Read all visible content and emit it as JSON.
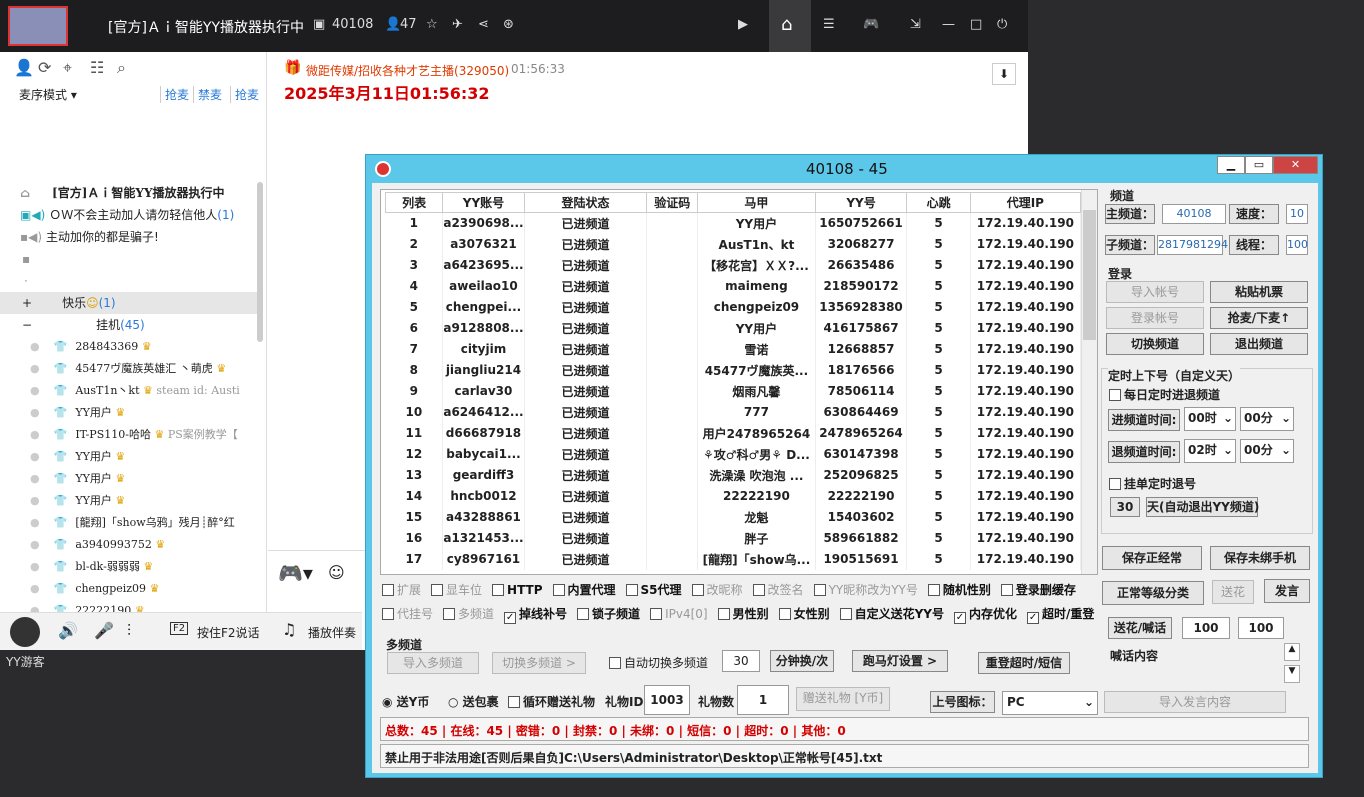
{
  "yy": {
    "title": "[官方]Ａｉ智能YY播放器执行中",
    "room_id": "40108",
    "online": "47",
    "left_tabs": [
      "抢麦",
      "禁麦",
      "抢麦"
    ],
    "mode": "麦序模式",
    "channels": [
      {
        "name": "[官方]Ａｉ智能YY播放器执行中"
      },
      {
        "name": "ＯＷ不会主动加人请勿轻信他人",
        "count": "(1)"
      },
      {
        "name": "主动加你的都是骗子!"
      },
      {
        "name": ""
      },
      {
        "name": "·"
      }
    ],
    "group_happy": "快乐",
    "group_happy_count": "(1)",
    "group_hang": "挂机",
    "group_hang_count": "(45)",
    "users": [
      {
        "name": "284843369",
        "badge": "♛"
      },
      {
        "name": "45477ヴ魔族英雄汇 丶萌虎",
        "badge": "♛"
      },
      {
        "name": "AusT1n丶kt",
        "badge": "♛",
        "sub": "steam id: Austi"
      },
      {
        "name": "YY用户",
        "badge": "♛"
      },
      {
        "name": "IT-PS110-哈哈",
        "badge": "♛",
        "sub": "PS案例教学【"
      },
      {
        "name": "YY用户",
        "badge": "♛"
      },
      {
        "name": "YY用户",
        "badge": "♛"
      },
      {
        "name": "YY用户",
        "badge": "♛"
      },
      {
        "name": "[龍翔]「show乌鸦」残月┊醉°红",
        "badge": ""
      },
      {
        "name": "a3940993752",
        "badge": "♛"
      },
      {
        "name": "bl-dk-弱弱弱",
        "badge": "♛"
      },
      {
        "name": "chengpeiz09",
        "badge": "♛"
      },
      {
        "name": "22222190",
        "badge": "♛"
      }
    ],
    "chat_sender": "微距传媒/招收各种才艺主播(329050)",
    "chat_time": "01:56:33",
    "chat_msg": "2025年3月11日01:56:32",
    "bottom_f2": "按住F2说话",
    "bottom_music": "播放伴奏",
    "guest": "YY游客",
    "colors": {
      "accent": "#e03a00",
      "red": "#d40000"
    }
  },
  "tool": {
    "title": "40108 - 45",
    "columns": [
      "列表",
      "YY账号",
      "登陆状态",
      "验证码",
      "马甲",
      "YY号",
      "心跳",
      "代理IP"
    ],
    "rows": [
      [
        "1",
        "a2390698...",
        "已进频道",
        "",
        "YY用户",
        "1650752661",
        "5",
        "172.19.40.190"
      ],
      [
        "2",
        "a3076321",
        "已进频道",
        "",
        "AusT1n、kt",
        "32068277",
        "5",
        "172.19.40.190"
      ],
      [
        "3",
        "a6423695...",
        "已进频道",
        "",
        "【移花宫】ＸＸ?...",
        "26635486",
        "5",
        "172.19.40.190"
      ],
      [
        "4",
        "aweilao10",
        "已进频道",
        "",
        "maimeng",
        "218590172",
        "5",
        "172.19.40.190"
      ],
      [
        "5",
        "chengpei...",
        "已进频道",
        "",
        "chengpeiz09",
        "1356928380",
        "5",
        "172.19.40.190"
      ],
      [
        "6",
        "a9128808...",
        "已进频道",
        "",
        "YY用户",
        "416175867",
        "5",
        "172.19.40.190"
      ],
      [
        "7",
        "cityjim",
        "已进频道",
        "",
        "雪诺",
        "12668857",
        "5",
        "172.19.40.190"
      ],
      [
        "8",
        "jiangliu214",
        "已进频道",
        "",
        "45477ヴ魔族英...",
        "18176566",
        "5",
        "172.19.40.190"
      ],
      [
        "9",
        "carlav30",
        "已进频道",
        "",
        "烟雨凡馨",
        "78506114",
        "5",
        "172.19.40.190"
      ],
      [
        "10",
        "a6246412...",
        "已进频道",
        "",
        "777",
        "630864469",
        "5",
        "172.19.40.190"
      ],
      [
        "11",
        "d66687918",
        "已进频道",
        "",
        "用户2478965264",
        "2478965264",
        "5",
        "172.19.40.190"
      ],
      [
        "12",
        "babycai1...",
        "已进频道",
        "",
        "⚘攻♂科♂男⚘ D...",
        "630147398",
        "5",
        "172.19.40.190"
      ],
      [
        "13",
        "geardiff3",
        "已进频道",
        "",
        "洗澡澡 吹泡泡 ...",
        "252096825",
        "5",
        "172.19.40.190"
      ],
      [
        "14",
        "hncb0012",
        "已进频道",
        "",
        "22222190",
        "22222190",
        "5",
        "172.19.40.190"
      ],
      [
        "15",
        "a43288861",
        "已进频道",
        "",
        "龙魁",
        "15403602",
        "5",
        "172.19.40.190"
      ],
      [
        "16",
        "a1321453...",
        "已进频道",
        "",
        "胖子",
        "589661882",
        "5",
        "172.19.40.190"
      ],
      [
        "17",
        "cy8967161",
        "已进频道",
        "",
        "[龍翔]「show乌...",
        "190515691",
        "5",
        "172.19.40.190"
      ]
    ],
    "channel_grp": "频道",
    "main_ch_label": "主频道：",
    "main_ch": "40108",
    "speed_label": "速度：",
    "speed": "10",
    "sub_ch_label": "子频道：",
    "sub_ch": "2817981294",
    "thread_label": "线程：",
    "thread": "100",
    "login_grp": "登录",
    "import_acc": "导入帐号",
    "paste_ticket": "粘贴机票",
    "login_acc": "登录帐号",
    "grab_mic": "抢麦/下麦↑",
    "switch_ch": "切换频道",
    "exit_ch": "退出频道",
    "timer_grp": "定时上下号（自定义天）",
    "daily_enter": "每日定时进退频道",
    "enter_time_label": "进频道时间:",
    "enter_h": "00时",
    "enter_m": "00分",
    "exit_time_label": "退频道时间:",
    "exit_h": "02时",
    "exit_m": "00分",
    "hang_exit": "挂单定时退号",
    "days": "30",
    "days_label": "天(自动退出YY频道)",
    "save_normal": "保存正经常",
    "save_unbound": "保存未绑手机",
    "normal_class": "正常等级分类",
    "send_flower": "送花",
    "speak": "发言",
    "opts1": [
      "扩展",
      "显车位",
      "HTTP",
      "内置代理",
      "S5代理",
      "改昵称",
      "改签名",
      "YY昵称改为YY号",
      "随机性别",
      "登录删缓存"
    ],
    "opts2": [
      "代挂号",
      "多频道",
      "掉线补号",
      "锁子频道",
      "IPv4[0]",
      "男性别",
      "女性别",
      "自定义送花YY号",
      "内存优化",
      "超时/重登"
    ],
    "flower_shout": "送花/喊话",
    "n1": "100",
    "n2": "100",
    "shout_content": "喊话内容",
    "multi_grp": "多频道",
    "import_multi": "导入多频道",
    "switch_multi": "切换多频道 >",
    "auto_switch": "自动切换多频道",
    "minutes": "30",
    "minutes_label": "分钟换/次",
    "marquee": "跑马灯设置 >",
    "relogin": "重登超时/短信",
    "send_y": "送Y币",
    "send_pkg": "送包裹",
    "loop_gift": "循环赠送礼物",
    "gift_id_label": "礼物ID",
    "gift_id": "1003",
    "gift_num_label": "礼物数",
    "gift_num": "1",
    "give_gift": "赠送礼物 [Y币]",
    "icon_label": "上号图标：",
    "icon_val": "PC",
    "import_speech": "导入发言内容",
    "stats": "总数：45  |  在线：45  |  密错：0  |  封禁：0  |  未绑：0  |  短信：0  |  超时：0  |  其他：0",
    "status_path": "禁止用于非法用途[否则后果自负]C:\\Users\\Administrator\\Desktop\\正常帐号[45].txt"
  }
}
